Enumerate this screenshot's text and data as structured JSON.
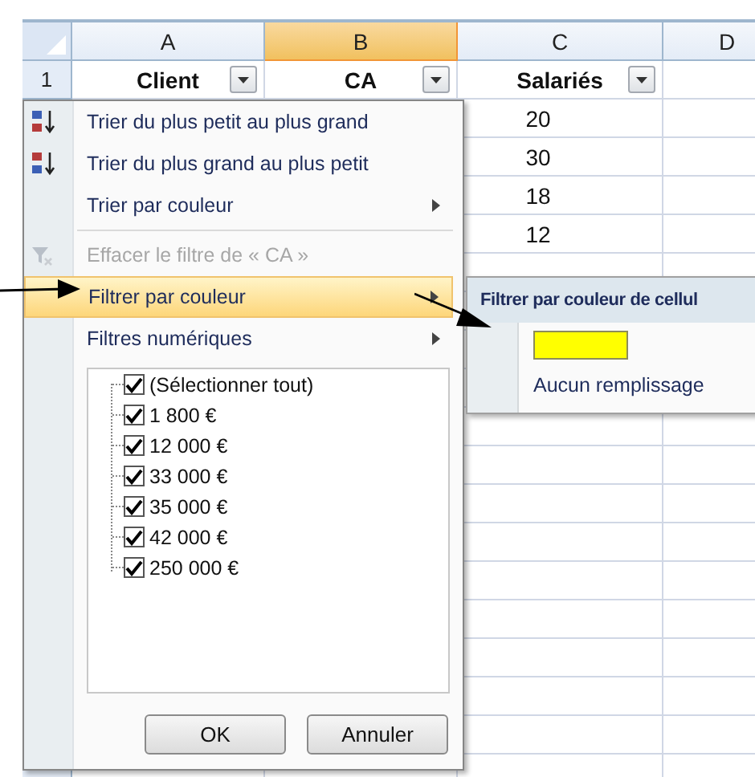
{
  "columns": [
    {
      "label": "A",
      "selected": false
    },
    {
      "label": "B",
      "selected": true
    },
    {
      "label": "C",
      "selected": false
    },
    {
      "label": "D",
      "selected": false
    }
  ],
  "header_row": {
    "number": "1",
    "cells": [
      {
        "text": "Client",
        "filter": true
      },
      {
        "text": "CA",
        "filter": true
      },
      {
        "text": "Salariés",
        "filter": true
      }
    ]
  },
  "column_c_cells": [
    "20",
    "30",
    "18",
    "12"
  ],
  "filter_menu": {
    "items": [
      {
        "kind": "ascending",
        "label": "Trier du plus petit au plus grand",
        "submenu": false,
        "disabled": false,
        "selected": false
      },
      {
        "kind": "descending",
        "label": "Trier du plus grand au plus petit",
        "submenu": false,
        "disabled": false,
        "selected": false
      },
      {
        "kind": "plain",
        "label": "Trier par couleur",
        "submenu": true,
        "disabled": false,
        "selected": false
      },
      {
        "kind": "separator"
      },
      {
        "kind": "clear",
        "label": "Effacer le filtre de « CA »",
        "submenu": false,
        "disabled": true,
        "selected": false
      },
      {
        "kind": "plain",
        "label": "Filtrer par couleur",
        "submenu": true,
        "disabled": false,
        "selected": true
      },
      {
        "kind": "plain",
        "label": "Filtres numériques",
        "submenu": true,
        "disabled": false,
        "selected": false
      }
    ],
    "values": [
      {
        "label": "(Sélectionner tout)",
        "checked": true
      },
      {
        "label": "1 800 €",
        "checked": true
      },
      {
        "label": "12 000 €",
        "checked": true
      },
      {
        "label": "33 000 €",
        "checked": true
      },
      {
        "label": "35 000 €",
        "checked": true
      },
      {
        "label": "42 000 €",
        "checked": true
      },
      {
        "label": "250 000 €",
        "checked": true
      }
    ],
    "buttons": [
      "OK",
      "Annuler"
    ]
  },
  "color_submenu": {
    "title": "Filtrer par couleur de cellul",
    "swatches": [
      {
        "color": "#ffff00"
      }
    ],
    "no_fill": "Aucun remplissage"
  }
}
